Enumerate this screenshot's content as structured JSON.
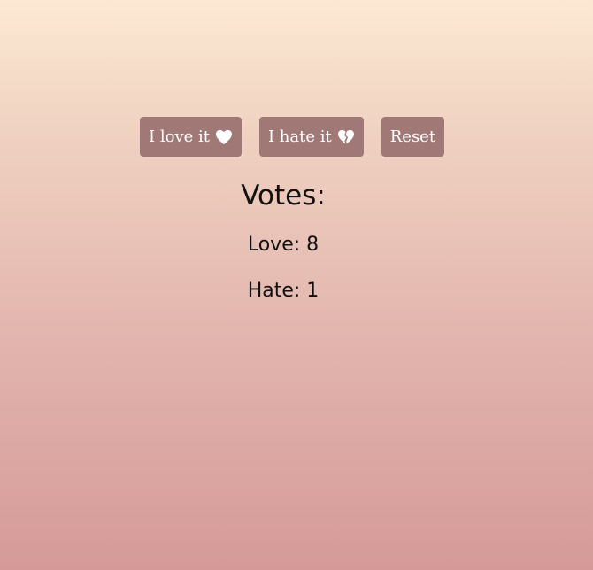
{
  "buttons": {
    "love_label": "I love it",
    "love_icon": "heart-icon",
    "hate_label": "I hate it",
    "hate_icon": "broken-heart-icon",
    "reset_label": "Reset"
  },
  "votes": {
    "title": "Votes:",
    "love_label": "Love:",
    "love_count": "8",
    "hate_label": "Hate:",
    "hate_count": "1"
  },
  "colors": {
    "button_bg": "#a07876",
    "button_text": "#ffffff",
    "gradient_top": "#fce9d3",
    "gradient_bottom": "#d59a98"
  }
}
